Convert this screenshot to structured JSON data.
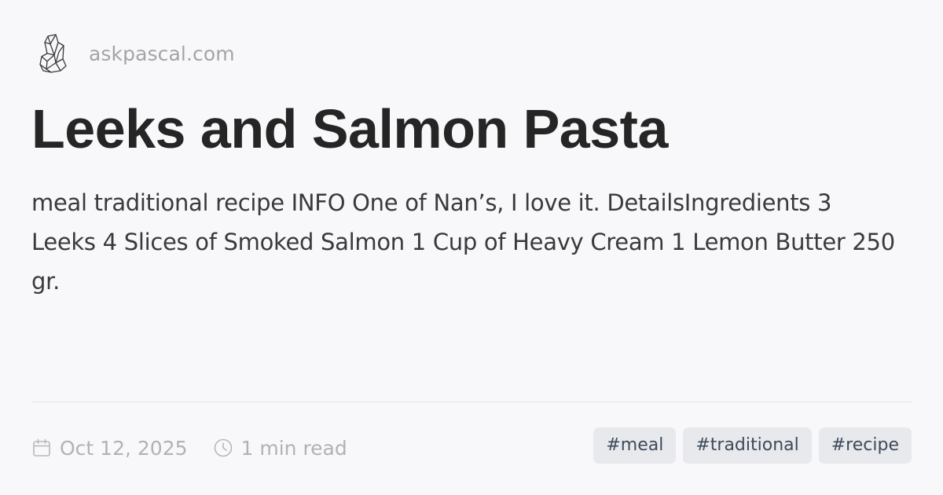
{
  "site": {
    "logo_icon": "crystal-cluster-icon",
    "name": "askpascal.com"
  },
  "post": {
    "title": "Leeks and Salmon Pasta",
    "description": "meal traditional recipe INFO One of Nan’s, I love it. DetailsIngredients 3 Leeks 4 Slices of Smoked Salmon 1 Cup of Heavy Cream 1 Lemon Butter 250 gr."
  },
  "meta": {
    "date_icon": "calendar-icon",
    "date": "Oct 12, 2025",
    "read_icon": "clock-icon",
    "read_time": "1 min read"
  },
  "tags": [
    "#meal",
    "#traditional",
    "#recipe"
  ],
  "colors": {
    "background": "#f8f7f9",
    "title": "#252525",
    "muted": "#a4a4a8",
    "tag_background": "#e8e9ec",
    "tag_text": "#3c4a5c"
  }
}
